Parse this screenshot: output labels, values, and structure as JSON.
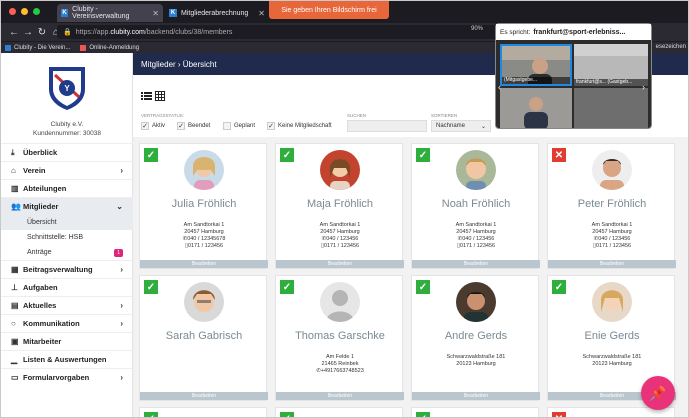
{
  "browser": {
    "tabs": [
      {
        "label": "Clubity - Vereinsverwaltung",
        "favicon": "K"
      },
      {
        "label": "Mitgliederabrechnung",
        "favicon": "K"
      }
    ],
    "share_banner": "Sie geben Ihren Bildschirm frei",
    "url_prefix": "https://app.",
    "url_domain": "clubity.com",
    "url_path": "/backend/clubs/38/members",
    "zoom": "90%",
    "bookmarks": [
      "Clubity - Die Verein...",
      "Online-Anmeldung"
    ],
    "bookmarks_right": "esezeichen"
  },
  "sidebar": {
    "club_name": "Clubity e.V.",
    "club_number": "Kundennummer: 30038",
    "items": [
      {
        "label": "Überblick",
        "icon": "download-icon",
        "chev": ""
      },
      {
        "label": "Verein",
        "icon": "home-icon",
        "chev": ">"
      },
      {
        "label": "Abteilungen",
        "icon": "building-icon",
        "chev": ""
      },
      {
        "label": "Mitglieder",
        "icon": "users-icon",
        "chev": "v"
      },
      {
        "label": "Beitragsverwaltung",
        "icon": "calculator-icon",
        "chev": ">"
      },
      {
        "label": "Aufgaben",
        "icon": "pin-icon",
        "chev": ""
      },
      {
        "label": "Aktuelles",
        "icon": "news-icon",
        "chev": ">"
      },
      {
        "label": "Kommunikation",
        "icon": "chat-icon",
        "chev": ">"
      },
      {
        "label": "Mitarbeiter",
        "icon": "id-card-icon",
        "chev": ""
      },
      {
        "label": "Listen & Auswertungen",
        "icon": "chart-icon",
        "chev": ""
      },
      {
        "label": "Formularvorgaben",
        "icon": "form-icon",
        "chev": ">"
      }
    ],
    "sub_items": [
      {
        "label": "Übersicht"
      },
      {
        "label": "Schnittstelle: HSB"
      },
      {
        "label": "Anträge",
        "badge": "1"
      }
    ]
  },
  "main": {
    "breadcrumb": "Mitglieder › Übersicht",
    "filters": {
      "status_label": "VERTRAGSSTATUS:",
      "search_label": "SUCHEN",
      "sort_label": "SORTIEREN",
      "sort_value": "Nachname",
      "status_options": [
        {
          "label": "Aktiv",
          "checked": "✓"
        },
        {
          "label": "Beendet",
          "checked": "✓"
        },
        {
          "label": "Geplant",
          "checked": ""
        },
        {
          "label": "Keine Mitgliedschaft",
          "checked": "✓"
        }
      ]
    },
    "edit_label": "Bearbeiten",
    "members": [
      {
        "name": "Julia Fröhlich",
        "status": "ok",
        "addr1": "Am Sandtorkai 1",
        "addr2": "20457 Hamburg",
        "phone": "040 / 12345678",
        "mobile": "0171 / 123456"
      },
      {
        "name": "Maja Fröhlich",
        "status": "ok",
        "addr1": "Am Sandtorkai 1",
        "addr2": "20457 Hamburg",
        "phone": "040 / 123456",
        "mobile": "0171 / 123456"
      },
      {
        "name": "Noah Fröhlich",
        "status": "ok",
        "addr1": "Am Sandtorkai 1",
        "addr2": "20457 Hamburg",
        "phone": "040 / 123456",
        "mobile": "0171 / 123456"
      },
      {
        "name": "Peter Fröhlich",
        "status": "no",
        "addr1": "Am Sandtorkai 1",
        "addr2": "20457 Hamburg",
        "phone": "040 / 123456",
        "mobile": "0171 / 123456"
      },
      {
        "name": "Sarah Gabrisch",
        "status": "ok",
        "addr1": "",
        "addr2": "",
        "phone": "",
        "mobile": ""
      },
      {
        "name": "Thomas Garschke",
        "status": "ok",
        "addr1": "Am Felde 1",
        "addr2": "21465 Reinbek",
        "phone": "+4917663748523",
        "mobile": ""
      },
      {
        "name": "Andre Gerds",
        "status": "ok",
        "addr1": "Schwarzwaldstraße 181",
        "addr2": "20123 Hamburg",
        "phone": "",
        "mobile": ""
      },
      {
        "name": "Enie Gerds",
        "status": "ok",
        "addr1": "Schwarzwaldstraße 181",
        "addr2": "20123 Hamburg",
        "phone": "",
        "mobile": ""
      }
    ]
  },
  "video": {
    "speaker_prefix": "Es spricht:",
    "speaker_name": "frankfurt@sport-erlebniss...",
    "tiles": [
      "(Mitgastgebe...",
      "frankfurt@s... (Gastgeb..."
    ]
  },
  "colors": {
    "header": "#1f2a4d",
    "ok": "#2eae3d",
    "no": "#e03c31",
    "fab": "#e8337a",
    "name": "#7b8a92"
  }
}
